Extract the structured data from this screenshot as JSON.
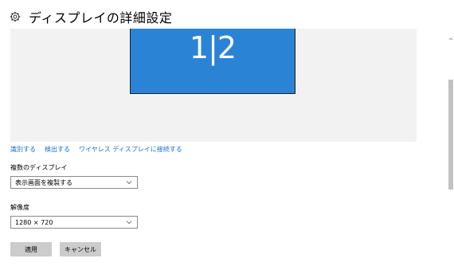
{
  "header": {
    "title": "ディスプレイの詳細設定",
    "icon": "gear-icon"
  },
  "preview": {
    "monitor_label": "1|2",
    "monitor_color": "#2b83d6",
    "background_color": "#f2f2f2"
  },
  "links": {
    "identify": "識別する",
    "detect": "検出する",
    "wireless": "ワイヤレス ディスプレイに接続する",
    "color": "#1e72c8"
  },
  "multiple_displays": {
    "label": "複数のディスプレイ",
    "selected": "表示画面を複製する"
  },
  "resolution": {
    "label": "解像度",
    "selected": "1280 × 720"
  },
  "buttons": {
    "apply": "適用",
    "cancel": "キャンセル"
  }
}
